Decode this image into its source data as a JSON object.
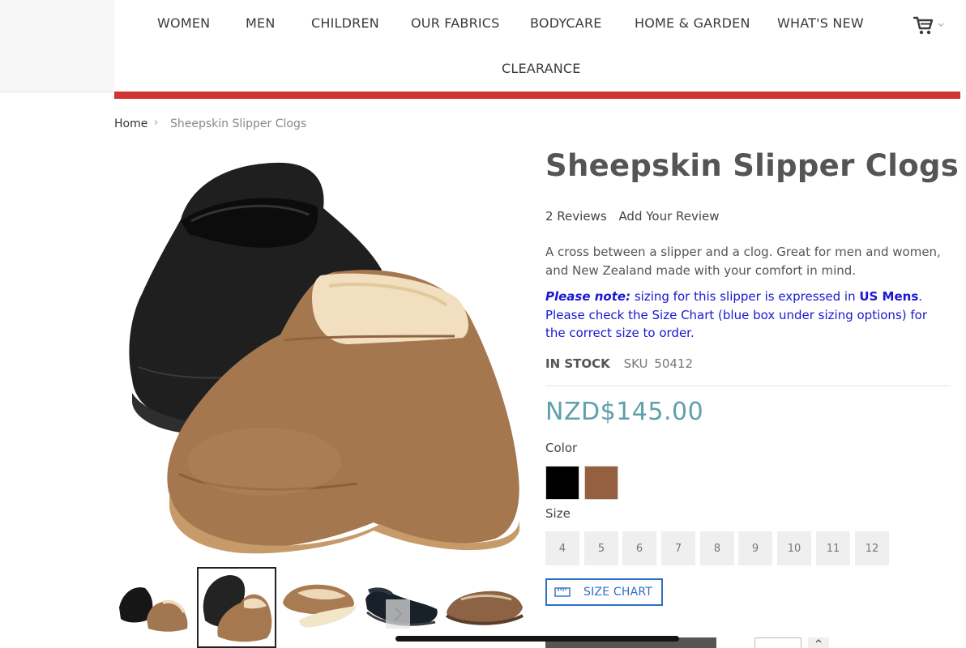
{
  "nav": {
    "items": [
      "WOMEN",
      "MEN",
      "CHILDREN",
      "OUR FABRICS",
      "BODYCARE",
      "HOME & GARDEN",
      "WHAT'S NEW",
      "CLEARANCE"
    ],
    "cart_icon": "cart-icon"
  },
  "brand": {
    "accent_red": "#d03531",
    "price_color": "#5ea0ab",
    "note_blue": "#1818d0",
    "chart_blue": "#2f6fc4"
  },
  "breadcrumb": {
    "home": "Home",
    "separator": "›",
    "current": "Sheepskin Slipper Clogs"
  },
  "product": {
    "title": "Sheepskin Slipper Clogs",
    "reviews": "2 Reviews",
    "add_review": "Add Your Review",
    "description": "A cross between a slipper and a clog. Great for men and women, and New Zealand made with your comfort in mind.",
    "note": {
      "lead": "Please note:",
      "part1": " sizing for this slipper is expressed in ",
      "emphasis": "US Mens",
      "part2": ". Please check the Size Chart (blue box under sizing options) for the correct size to order."
    },
    "stock": "IN STOCK",
    "sku_label": "SKU",
    "sku": "50412",
    "price": "NZD$145.00",
    "color_label": "Color",
    "colors": [
      {
        "name": "Black",
        "hex": "#000000"
      },
      {
        "name": "Chestnut",
        "hex": "#94603f"
      }
    ],
    "size_label": "Size",
    "sizes": [
      "4",
      "5",
      "6",
      "7",
      "8",
      "9",
      "10",
      "11",
      "12"
    ],
    "size_chart": "SIZE CHART",
    "size_chart_icon": "ruler-icon"
  },
  "gallery": {
    "thumbnail_count": 5,
    "selected_index": 1,
    "next_icon": "chevron-right-icon"
  }
}
